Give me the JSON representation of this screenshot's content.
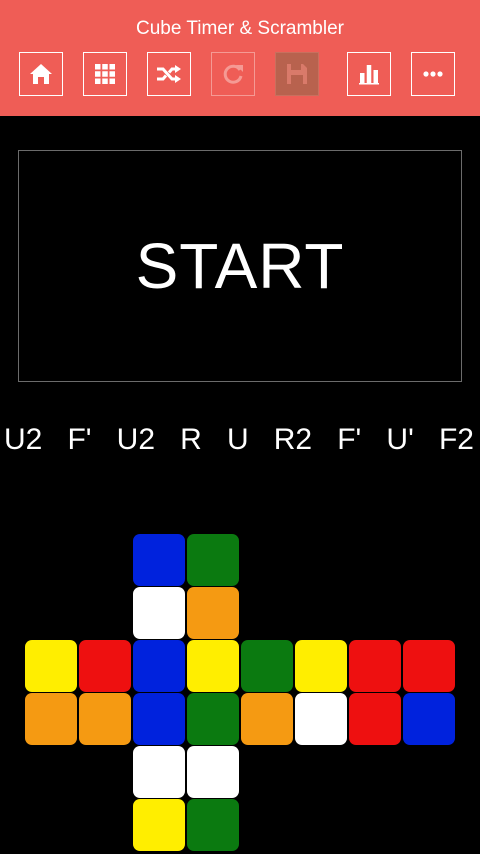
{
  "header": {
    "title": "Cube Timer & Scrambler"
  },
  "toolbar": {
    "buttons": [
      {
        "icon": "home-icon",
        "enabled": true
      },
      {
        "icon": "grid-icon",
        "enabled": true
      },
      {
        "icon": "shuffle-icon",
        "enabled": true
      },
      {
        "icon": "refresh-icon",
        "enabled": false
      },
      {
        "icon": "save-icon",
        "enabled": false
      },
      {
        "icon": "bar-chart-icon",
        "enabled": true
      },
      {
        "icon": "more-icon",
        "enabled": true
      }
    ]
  },
  "timer": {
    "start_label": "START"
  },
  "scramble": {
    "moves": [
      "U2",
      "F'",
      "U2",
      "R",
      "U",
      "R2",
      "F'",
      "U'",
      "F2"
    ]
  },
  "colors": {
    "header_bg": "#ef5d56",
    "blue": "#0022dd",
    "green": "#0b7a10",
    "white": "#ffffff",
    "orange": "#f59a12",
    "yellow": "#ffee00",
    "red": "#ee1010"
  },
  "cube_net": {
    "up": [
      "blue",
      "green",
      "white",
      "orange"
    ],
    "left": [
      "yellow",
      "red",
      "orange",
      "orange"
    ],
    "front": [
      "blue",
      "yellow",
      "blue",
      "green"
    ],
    "right": [
      "green",
      "yellow",
      "orange",
      "white"
    ],
    "back": [
      "red",
      "red",
      "red",
      "blue"
    ],
    "down": [
      "white",
      "white",
      "yellow",
      "green"
    ]
  }
}
